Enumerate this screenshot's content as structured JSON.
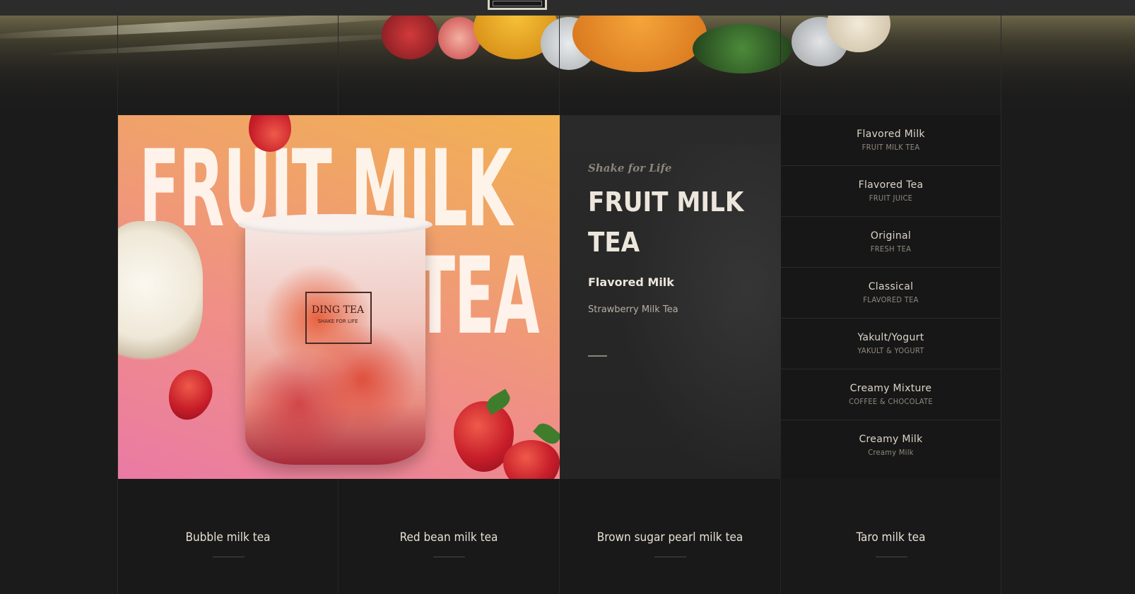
{
  "feature": {
    "image_text_line1": "FRUIT MILK",
    "image_text_line2": "TEA",
    "cup_brand": "DING TEA",
    "cup_slogan": "SHAKE FOR LIFE",
    "tagline": "Shake for Life",
    "title": "FRUIT MILK TEA",
    "category": "Flavored Milk",
    "subtitle": "Strawberry Milk Tea"
  },
  "menu": {
    "items": [
      {
        "label": "Flavored Milk",
        "sublabel": "FRUIT MILK TEA"
      },
      {
        "label": "Flavored Tea",
        "sublabel": "FRUIT JUICE"
      },
      {
        "label": "Original",
        "sublabel": "FRESH TEA"
      },
      {
        "label": "Classical",
        "sublabel": "FLAVORED TEA"
      },
      {
        "label": "Yakult/Yogurt",
        "sublabel": "YAKULT & YOGURT"
      },
      {
        "label": "Creamy Mixture",
        "sublabel": "COFFEE & CHOCOLATE"
      },
      {
        "label": "Creamy Milk",
        "sublabel": "Creamy Milk"
      }
    ]
  },
  "products": [
    {
      "name": "Bubble milk tea"
    },
    {
      "name": "Red bean milk tea"
    },
    {
      "name": "Brown sugar pearl milk tea"
    },
    {
      "name": "Taro milk tea"
    }
  ],
  "colors": {
    "background": "#1b1b1b",
    "panel": "#171717",
    "text_light": "#ece6dc",
    "text_muted": "#8f897f"
  }
}
